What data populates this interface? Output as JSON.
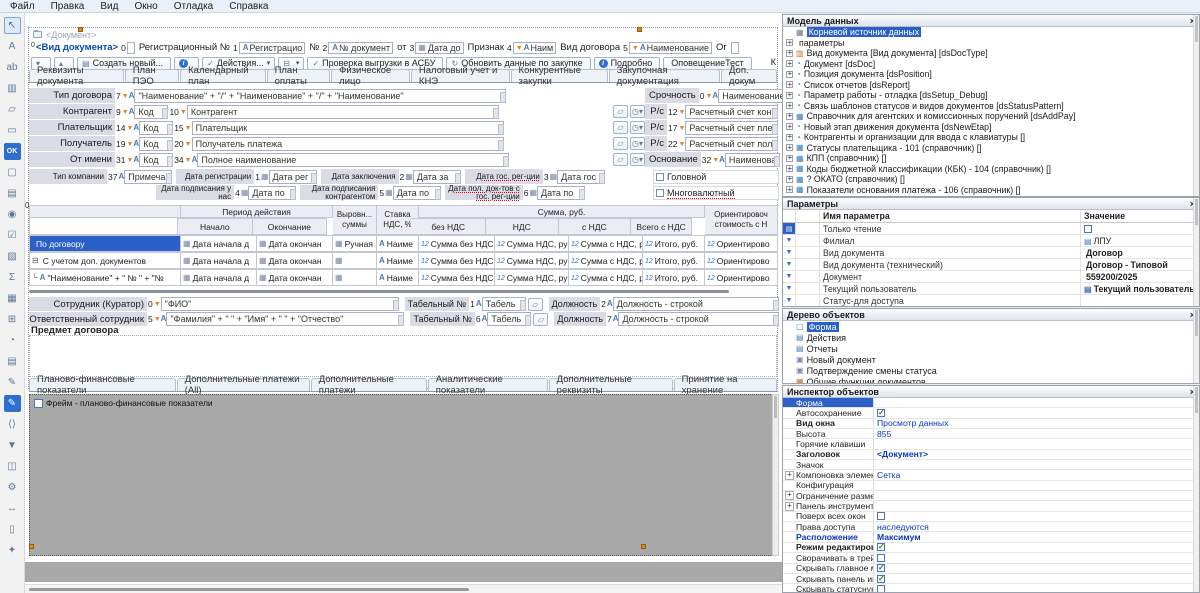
{
  "menu": {
    "items": [
      "Файл",
      "Правка",
      "Вид",
      "Окно",
      "Отладка",
      "Справка"
    ]
  },
  "palette": {
    "tools": [
      {
        "name": "pointer-tool-icon",
        "g": "↖",
        "sel": "1"
      },
      {
        "name": "label-tool-icon",
        "g": "A"
      },
      {
        "name": "textbox-tool-icon",
        "g": "ab"
      },
      {
        "name": "table-tool-icon",
        "g": "▥"
      },
      {
        "name": "folder-tool-icon",
        "g": "▱"
      },
      {
        "name": "panel-tool-icon",
        "g": "▭"
      },
      {
        "name": "ok-button-tool-icon",
        "g": "OK",
        "accent": "1"
      },
      {
        "name": "frame-tool-icon",
        "g": "▢"
      },
      {
        "name": "combo-tool-icon",
        "g": "▤"
      },
      {
        "name": "radio-tool-icon",
        "g": "◉"
      },
      {
        "name": "checkbox-tool-icon",
        "g": "☑"
      },
      {
        "name": "image-tool-icon",
        "g": "▨"
      },
      {
        "name": "grid-sum-tool-icon",
        "g": "Σ"
      },
      {
        "name": "calendar-tool-icon",
        "g": "▦"
      },
      {
        "name": "hierarchy-tool-icon",
        "g": "⊞"
      },
      {
        "name": "pie-chart-tool-icon",
        "g": "◔"
      },
      {
        "name": "document-tool-icon",
        "g": "▤"
      },
      {
        "name": "edit-document-tool-icon",
        "g": "✎"
      },
      {
        "name": "pen-tool-icon",
        "g": "✎",
        "sel2": "1"
      },
      {
        "name": "code-document-tool-icon",
        "g": "⟨⟩"
      },
      {
        "name": "open-folder-tool-icon",
        "g": "▼"
      },
      {
        "name": "ole-document-tool-icon",
        "g": "◫"
      },
      {
        "name": "gears-tool-icon",
        "g": "⚙"
      },
      {
        "name": "splitter-tool-icon",
        "g": "↔"
      },
      {
        "name": "page-tool-icon",
        "g": "▯"
      },
      {
        "name": "wand-tool-icon",
        "g": "✦"
      }
    ]
  },
  "canvas": {
    "title": "<Документ>",
    "header": {
      "items": [
        {
          "label": "<Вид документа>",
          "pre": "0",
          "num": "0",
          "cls": "doctype",
          "value": ""
        },
        {
          "label": "Регистрационный №",
          "num": "1",
          "k2": "a",
          "value": "Регистрацио"
        },
        {
          "label": "№",
          "num": "2",
          "k2": "a",
          "value": "№ документ"
        },
        {
          "label": "от",
          "num": "3",
          "k1": "cal",
          "value": "Дата до"
        },
        {
          "label": "Признак",
          "num": "4",
          "k1": "f",
          "k2": "a",
          "value": "Наим"
        },
        {
          "label": "Вид договора",
          "num": "5",
          "k1": "f",
          "k2": "a",
          "value": "Наименование"
        },
        {
          "label": "Ог",
          "num": "",
          "value": ""
        }
      ]
    },
    "toolbar": {
      "buttons": [
        {
          "label": "",
          "g": "▾",
          "name": "combo-down-button"
        },
        {
          "label": "",
          "g": "▴",
          "name": "combo-up-button"
        },
        {
          "label": "Создать новый...",
          "g": "▤",
          "name": "create-new-button"
        },
        {
          "label": "",
          "g": "i",
          "cls": "info",
          "name": "info-button"
        },
        {
          "label": "Действия...",
          "g": "✓",
          "arrow": "▾",
          "name": "actions-button"
        },
        {
          "label": "",
          "g": "⊟",
          "arrow": "▾",
          "name": "print-button"
        },
        {
          "label": "Проверка выгрузки в АСБУ",
          "g": "✓",
          "name": "verify-asbu-button"
        },
        {
          "label": "Обновить данные по закупке",
          "g": "↻",
          "name": "refresh-purchase-button"
        },
        {
          "label": "Подробно",
          "g": "i",
          "cls": "info",
          "name": "details-button"
        },
        {
          "label": "ОповещениеТест",
          "g": "",
          "name": "notification-test-button"
        }
      ],
      "edge": "К"
    },
    "tabs": [
      "Реквизиты документа",
      "План ПЭО",
      "Календарный план",
      "План оплаты",
      "Физическое лицо",
      "Налоговый учет и КНЭ",
      "Конкурентные закупки",
      "Закупочная документация",
      "Доп. докум"
    ],
    "fieldsL": {
      "row1": {
        "label": "Тип договора",
        "num": "7",
        "value": "\"Наименование\" + \"/\" + \"Наименование\" + \"/\" + \"Наименование\""
      },
      "rows": [
        {
          "label": "Контрагент",
          "num1": "9",
          "v1": "Код",
          "num2": "10",
          "v2": "Контрагент"
        },
        {
          "label": "Плательщик",
          "num1": "14",
          "v1": "Код",
          "num2": "15",
          "v2": "Плательщик"
        },
        {
          "label": "Получатель",
          "num1": "19",
          "v1": "Код",
          "num2": "20",
          "v2": "Получатель платежа"
        },
        {
          "label": "От имени",
          "num1": "31",
          "v1": "Код",
          "num2": "34",
          "k4": "a",
          "v2": "Полное наименование"
        }
      ]
    },
    "fieldsR": {
      "rows": [
        {
          "label": "Срочность",
          "num": "0",
          "k2": "a",
          "value": "Наименование"
        },
        {
          "label": "Р/с",
          "num": "12",
          "value": "Расчетный счет кон"
        },
        {
          "label": "Р/с",
          "num": "17",
          "value": "Расчетный счет пле"
        },
        {
          "label": "Р/с",
          "num": "22",
          "value": "Расчетный счет пол"
        },
        {
          "label": "Основание",
          "num": "32",
          "k2": "a",
          "value": "Наименова",
          "extra": "З"
        }
      ]
    },
    "checks": [
      {
        "label": "Головной"
      },
      {
        "label": "Многовалютный",
        "u": "1"
      }
    ],
    "dates": {
      "r1": [
        {
          "label": "Тип компании",
          "num": "37",
          "k": "a",
          "value": "Примечан"
        },
        {
          "label": "Дата регистрации",
          "num": "1",
          "k": "cal",
          "value": "Дата рег"
        },
        {
          "label": "Дата заключения",
          "num": "2",
          "k": "cal",
          "value": "Дата за"
        },
        {
          "label": "Дата гос. рег-ции",
          "num": "3",
          "k": "cal",
          "value": "Дата гос",
          "u": "1"
        }
      ],
      "r2": [
        {
          "label": "Дата подписания у нас",
          "num": "4",
          "k": "cal",
          "value": "Дата по"
        },
        {
          "label": "Дата подписания контрагентом",
          "num": "5",
          "k": "cal",
          "value": "Дата по"
        },
        {
          "label": "Дата пол. док-тов с гос. рег-ции",
          "num": "6",
          "k": "cal",
          "value": "Дата по",
          "u": "1"
        }
      ]
    },
    "table": {
      "corner": "0",
      "h_period": "Период действия",
      "h_start": "Начало",
      "h_end": "Окончание",
      "h_align1": "Выровн...",
      "h_align2": "суммы",
      "h_rate1": "Ставка",
      "h_rate2": "НДС, %",
      "h_sum": "Сумма, руб.",
      "h_c1": "без НДС",
      "h_c2": "НДС",
      "h_c3": "с НДС",
      "h_c4": "Всего с НДС",
      "h_est1": "Ориентировоч",
      "h_est2": "стоимость с Н",
      "rows": [
        {
          "name": "По договору",
          "sel": "1",
          "start": "Дата начала д",
          "end": "Дата окончан",
          "manual": "Ручная",
          "rate": "Наиме",
          "c1": "Сумма без НДС",
          "c2": "Сумма НДС, руб",
          "c3": "Сумма с НДС, р",
          "c4": "Итого, руб.",
          "c5": "Ориентирово"
        },
        {
          "name": "С учетом доп. документов",
          "pre": "⊟",
          "start": "Дата начала д",
          "end": "Дата окончан",
          "manual": "",
          "rate": "Наиме",
          "c1": "Сумма без НДС",
          "c2": "Сумма НДС, руб",
          "c3": "Сумма с НДС, р",
          "c4": "Итого, руб.",
          "c5": "Ориентирово"
        },
        {
          "name": "\"Наименование\" + \" № \" + \"№",
          "pre": "└",
          "ka": "a",
          "start": "Дата начала д",
          "end": "Дата окончан",
          "manual": "",
          "rate": "Наиме",
          "c1": "Сумма без НДС",
          "c2": "Сумма НДС, руб",
          "c3": "Сумма с НДС, р",
          "c4": "Итого, руб.",
          "c5": "Ориентирово"
        }
      ]
    },
    "employees": {
      "tab_label": "Табельный №",
      "pos_label": "Должность",
      "rows": [
        {
          "label": "Сотрудник (Куратор)",
          "num": "0",
          "value": "\"ФИО\"",
          "tnum": "1",
          "tval": "Табель",
          "dnum": "2",
          "dval": "Должность - строкой"
        },
        {
          "label": "Ответственный сотрудник",
          "num": "5",
          "k2": "a",
          "value": "\"Фамилия\" + \" \" + \"Имя\" + \" \" + \"Отчество\"",
          "tnum": "6",
          "tval": "Табель",
          "dnum": "7",
          "dval": "Должность - строкой"
        }
      ]
    },
    "subject": "Предмет договора",
    "bottom_tabs": [
      "Планово-финансовые показатели",
      "Дополнительные платежи (All)",
      "Дополнительные платежи",
      "Аналитические показатели",
      "Дополнительные реквизиты",
      "Принятие на хранение"
    ],
    "frame_label": "Фрейм - планово-финансовые показатели"
  },
  "panels": {
    "model": {
      "title": "Модель данных",
      "items": [
        {
          "t": "Корневой источник данных",
          "ico": "root",
          "sel": "1"
        },
        {
          "t": "параметры",
          "exp": "+"
        },
        {
          "t": "Вид документа [Вид документа] [dsDocType]",
          "exp": "+",
          "ico": "tbl2"
        },
        {
          "t": "Документ [dsDoc]",
          "exp": "+",
          "ico": "qry"
        },
        {
          "t": "Позиция документа [dsPosition]",
          "exp": "+",
          "ico": "qry"
        },
        {
          "t": "Список отчетов [dsReport]",
          "exp": "+",
          "ico": "qry"
        },
        {
          "t": "Параметр работы - отладка [dsSetup_Debug]",
          "exp": "+",
          "ico": "qry2"
        },
        {
          "t": "Связь шаблонов статусов и видов документов [dsStatusPattern]",
          "exp": "+",
          "ico": "qry"
        },
        {
          "t": "Справочник для агентских и комиссионных поручений [dsAddPay]",
          "exp": "+",
          "ico": "tbl"
        },
        {
          "t": "Новый этап движения документа [dsNewEtap]",
          "exp": "+",
          "ico": "qry"
        },
        {
          "t": "Контрагенты и организации для ввода с клавиатуры []",
          "exp": "+",
          "ico": "qry"
        },
        {
          "t": "Статусы плательщика - 101 (справочник) []",
          "exp": "+",
          "ico": "tbl"
        },
        {
          "t": "КПП (справочник) []",
          "exp": "+",
          "ico": "tbl"
        },
        {
          "t": "Коды бюджетной классификации (КБК) - 104 (справочник) []",
          "exp": "+",
          "ico": "tbl"
        },
        {
          "t": "? ОКАТО (справочник) []",
          "exp": "+",
          "ico": "tbl"
        },
        {
          "t": "Показатели основания платежа - 106 (справочник) []",
          "exp": "+",
          "ico": "tbl"
        }
      ]
    },
    "params": {
      "title": "Параметры",
      "col_name": "Имя параметра",
      "col_value": "Значение",
      "rows": [
        {
          "n": "Только чтение",
          "gut": "sel",
          "check": "off",
          "v": ""
        },
        {
          "n": "Филиал",
          "gut": "f",
          "vico": "list",
          "v": "ЛПУ"
        },
        {
          "n": "Вид документа",
          "gut": "f",
          "v": "Договор",
          "vb": "1"
        },
        {
          "n": "Вид документа (технический)",
          "gut": "f",
          "v": "Договор - Типовой",
          "vb": "1"
        },
        {
          "n": "Документ",
          "gut": "f",
          "v": "559200/2025",
          "vb": "1"
        },
        {
          "n": "Текущий пользователь",
          "gut": "f",
          "vico": "list",
          "v": "Текущий пользователь",
          "vb": "1"
        },
        {
          "n": "Статус-для доступа",
          "gut": "f",
          "v": ""
        }
      ]
    },
    "objtree": {
      "title": "Дерево объектов",
      "items": [
        {
          "t": "Форма",
          "sel": "1",
          "ico": "form"
        },
        {
          "t": "Действия",
          "ico": "act"
        },
        {
          "t": "Отчеты",
          "ico": "act"
        },
        {
          "t": "Новый документ",
          "ico": "subform"
        },
        {
          "t": "Подтверждение смены статуса",
          "ico": "subform"
        },
        {
          "t": "Общие функции документов",
          "ico": "mod"
        }
      ]
    },
    "inspector": {
      "title": "Инспектор объектов",
      "rows": [
        {
          "n": "Форма",
          "sel": "1",
          "ico": "form",
          "v": ""
        },
        {
          "n": "Автосохранение",
          "check": "on",
          "v": ""
        },
        {
          "n": "Вид окна",
          "nb": "1",
          "v": "Просмотр данных"
        },
        {
          "n": "Высота",
          "v": "855"
        },
        {
          "n": "Горячие клавиши",
          "v": ""
        },
        {
          "n": "Заголовок",
          "nb": "1",
          "v": "<Документ>",
          "vb": "1"
        },
        {
          "n": "Значок",
          "v": ""
        },
        {
          "n": "Компоновка элементов",
          "exp": "+",
          "v": "Сетка"
        },
        {
          "n": "Конфигурация",
          "v": ""
        },
        {
          "n": "Ограничение размеров",
          "exp": "+",
          "v": ""
        },
        {
          "n": "Панель инструментов",
          "exp": "+",
          "v": ""
        },
        {
          "n": "Поверх всех окон",
          "check": "off",
          "v": ""
        },
        {
          "n": "Права доступа",
          "v": "наследуются"
        },
        {
          "n": "Расположение",
          "nb": "1",
          "nblue": "1",
          "v": "Максимум",
          "vb": "1"
        },
        {
          "n": "Режим редактировани",
          "nb": "1",
          "check": "on",
          "v": ""
        },
        {
          "n": "Сворачивать в трей",
          "check": "off",
          "v": ""
        },
        {
          "n": "Скрывать главное меню",
          "check": "on",
          "v": ""
        },
        {
          "n": "Скрывать панель инструм",
          "check": "on",
          "v": ""
        },
        {
          "n": "Скрывать статусную стро",
          "check": "off",
          "v": ""
        }
      ]
    }
  }
}
